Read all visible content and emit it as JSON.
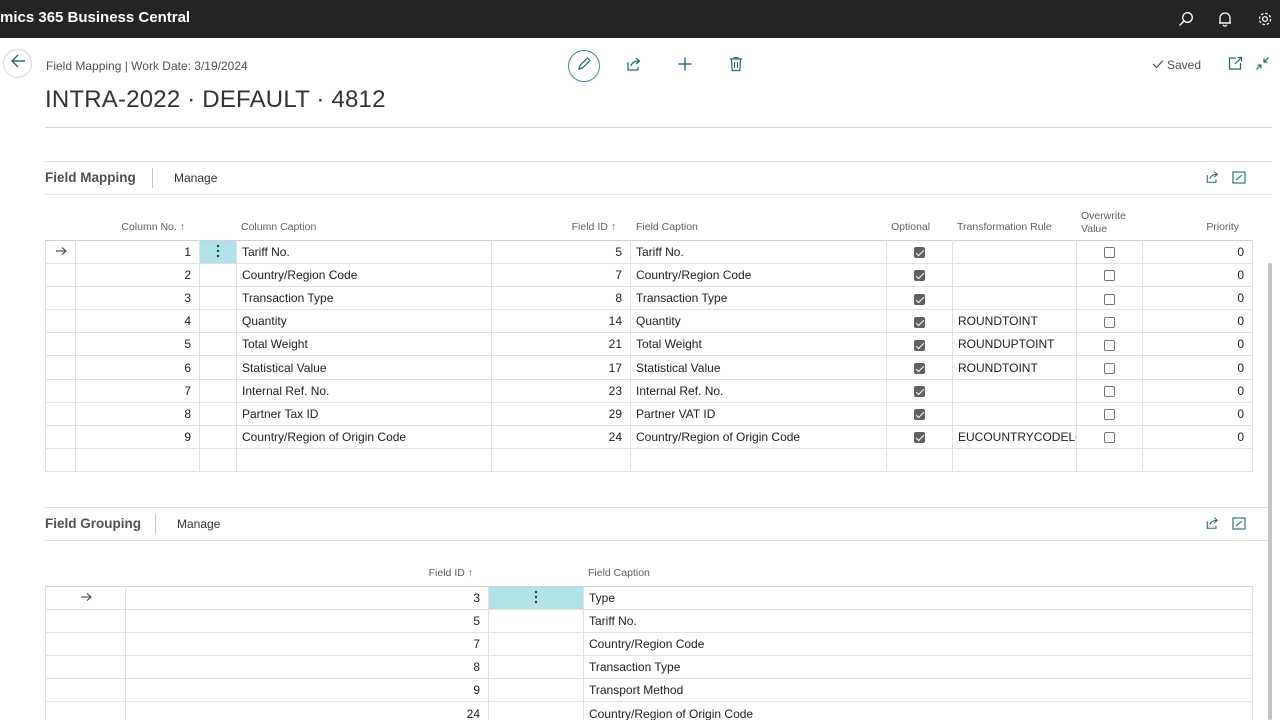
{
  "app": {
    "name": "mics 365 Business Central"
  },
  "header": {
    "breadcrumb": "Field Mapping | Work Date: 3/19/2024",
    "title": "INTRA-2022 · DEFAULT · 4812",
    "saved": "Saved"
  },
  "field_mapping": {
    "title": "Field Mapping",
    "manage": "Manage",
    "columns": {
      "column_no": "Column No.",
      "column_caption": "Column Caption",
      "field_id": "Field ID",
      "field_caption": "Field Caption",
      "optional": "Optional",
      "transformation_rule": "Transformation Rule",
      "overwrite_value_1": "Overwrite",
      "overwrite_value_2": "Value",
      "priority": "Priority"
    },
    "rows": [
      {
        "column_no": "1",
        "column_caption": "Tariff No.",
        "field_id": "5",
        "field_caption": "Tariff No.",
        "optional": true,
        "rule": "",
        "overwrite": false,
        "priority": "0"
      },
      {
        "column_no": "2",
        "column_caption": "Country/Region Code",
        "field_id": "7",
        "field_caption": "Country/Region Code",
        "optional": true,
        "rule": "",
        "overwrite": false,
        "priority": "0"
      },
      {
        "column_no": "3",
        "column_caption": "Transaction Type",
        "field_id": "8",
        "field_caption": "Transaction Type",
        "optional": true,
        "rule": "",
        "overwrite": false,
        "priority": "0"
      },
      {
        "column_no": "4",
        "column_caption": "Quantity",
        "field_id": "14",
        "field_caption": "Quantity",
        "optional": true,
        "rule": "ROUNDTOINT",
        "overwrite": false,
        "priority": "0"
      },
      {
        "column_no": "5",
        "column_caption": "Total Weight",
        "field_id": "21",
        "field_caption": "Total Weight",
        "optional": true,
        "rule": "ROUNDUPTOINT",
        "overwrite": false,
        "priority": "0"
      },
      {
        "column_no": "6",
        "column_caption": "Statistical Value",
        "field_id": "17",
        "field_caption": "Statistical Value",
        "optional": true,
        "rule": "ROUNDTOINT",
        "overwrite": false,
        "priority": "0"
      },
      {
        "column_no": "7",
        "column_caption": "Internal Ref. No.",
        "field_id": "23",
        "field_caption": "Internal Ref. No.",
        "optional": true,
        "rule": "",
        "overwrite": false,
        "priority": "0"
      },
      {
        "column_no": "8",
        "column_caption": "Partner Tax ID",
        "field_id": "29",
        "field_caption": "Partner VAT ID",
        "optional": true,
        "rule": "",
        "overwrite": false,
        "priority": "0"
      },
      {
        "column_no": "9",
        "column_caption": "Country/Region of Origin Code",
        "field_id": "24",
        "field_caption": "Country/Region of Origin Code",
        "optional": true,
        "rule": "EUCOUNTRYCODELO...",
        "overwrite": false,
        "priority": "0"
      }
    ]
  },
  "field_grouping": {
    "title": "Field Grouping",
    "manage": "Manage",
    "columns": {
      "field_id": "Field ID",
      "field_caption": "Field Caption"
    },
    "rows": [
      {
        "field_id": "3",
        "field_caption": "Type"
      },
      {
        "field_id": "5",
        "field_caption": "Tariff No."
      },
      {
        "field_id": "7",
        "field_caption": "Country/Region Code"
      },
      {
        "field_id": "8",
        "field_caption": "Transaction Type"
      },
      {
        "field_id": "9",
        "field_caption": "Transport Method"
      },
      {
        "field_id": "24",
        "field_caption": "Country/Region of Origin Code"
      }
    ]
  },
  "icons": {
    "search": "search-icon",
    "bell": "bell-icon",
    "settings": "gear-icon",
    "back": "back-arrow-icon",
    "edit": "pencil-icon",
    "share": "share-icon",
    "add": "plus-icon",
    "delete": "trash-icon",
    "saved": "check-icon",
    "popout": "open-in-new-window-icon",
    "collapse": "collapse-icon",
    "row_arrow": "row-arrow-icon",
    "more": "more-vertical-icon"
  },
  "colors": {
    "topbar": "#242424",
    "accent": "#3a8f8f",
    "selection": "#b1e3e8"
  }
}
